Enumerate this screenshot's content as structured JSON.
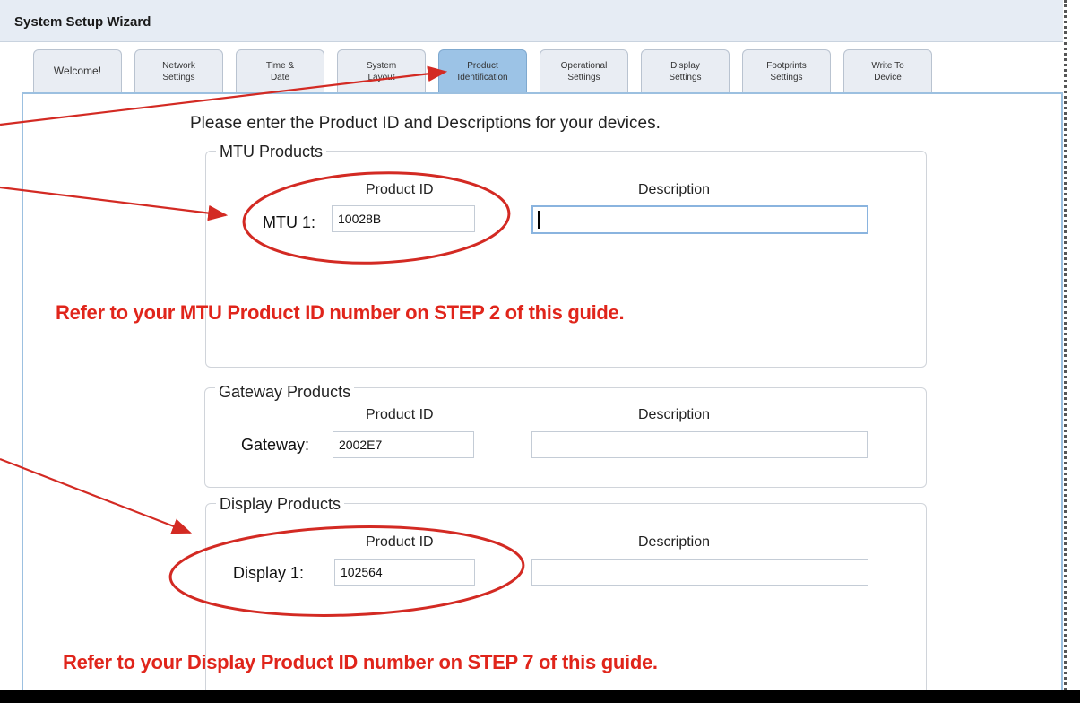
{
  "window": {
    "title": "System Setup Wizard"
  },
  "tabs": [
    {
      "label": "Welcome!",
      "active": false
    },
    {
      "label": "Network\nSettings",
      "active": false
    },
    {
      "label": "Time &\nDate",
      "active": false
    },
    {
      "label": "System\nLayout",
      "active": false
    },
    {
      "label": "Product\nIdentification",
      "active": true
    },
    {
      "label": "Operational\nSettings",
      "active": false
    },
    {
      "label": "Display\nSettings",
      "active": false
    },
    {
      "label": "Footprints\nSettings",
      "active": false
    },
    {
      "label": "Write To\nDevice",
      "active": false
    }
  ],
  "main": {
    "instruction": "Please enter the Product ID and Descriptions for your devices.",
    "mtu": {
      "legend": "MTU Products",
      "col_product_id": "Product ID",
      "col_description": "Description",
      "row_label": "MTU 1:",
      "product_id": "10028B",
      "description": ""
    },
    "gateway": {
      "legend": "Gateway Products",
      "col_product_id": "Product ID",
      "col_description": "Description",
      "row_label": "Gateway:",
      "product_id": "2002E7",
      "description": ""
    },
    "display": {
      "legend": "Display Products",
      "col_product_id": "Product ID",
      "col_description": "Description",
      "row_label": "Display 1:",
      "product_id": "102564",
      "description": ""
    }
  },
  "annotations": {
    "mtu_note": "Refer to your MTU Product ID number on STEP 2 of this guide.",
    "display_note": "Refer to your Display Product ID number on STEP 7 of this guide.",
    "color": "#e0251b"
  }
}
